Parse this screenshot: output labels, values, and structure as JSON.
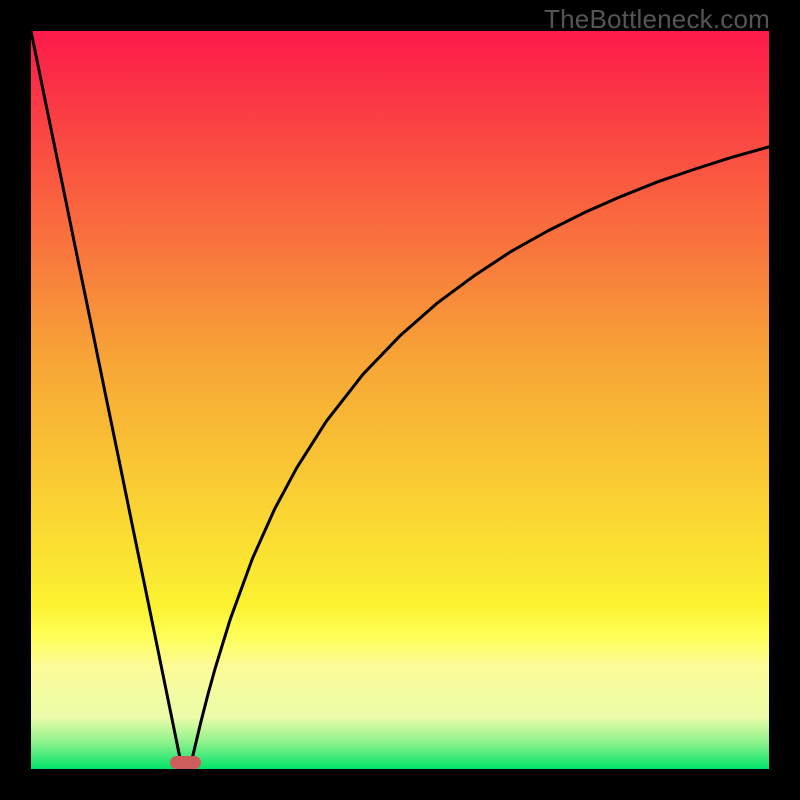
{
  "watermark": "TheBottleneck.com",
  "colors": {
    "frame_background": "#000000",
    "gradient_top": "#fc1a49",
    "gradient_mid1": "#f7a636",
    "gradient_mid2": "#fcf231",
    "gradient_band": "#fdfc98",
    "gradient_bottom": "#00e46a",
    "curve": "#000000",
    "marker": "#cd5d5c",
    "watermark": "#555557"
  },
  "chart_data": {
    "type": "line",
    "title": "",
    "xlabel": "",
    "ylabel": "",
    "xlim": [
      0,
      100
    ],
    "ylim": [
      0,
      100
    ],
    "grid": false,
    "series": [
      {
        "name": "bottleneck-curve",
        "x": [
          0,
          2,
          4,
          6,
          8,
          10,
          12,
          14,
          16,
          18,
          20,
          20.5,
          21.5,
          22,
          23,
          24,
          25,
          27,
          30,
          33,
          36,
          40,
          45,
          50,
          55,
          60,
          65,
          70,
          75,
          80,
          85,
          90,
          95,
          100
        ],
        "values": [
          100.0,
          90.2,
          80.5,
          70.7,
          61.0,
          51.2,
          41.5,
          31.7,
          22.0,
          12.2,
          2.4,
          0.0,
          0.0,
          2.1,
          6.3,
          10.2,
          13.8,
          20.3,
          28.5,
          35.2,
          40.8,
          47.1,
          53.5,
          58.7,
          63.1,
          66.8,
          70.1,
          72.9,
          75.4,
          77.6,
          79.6,
          81.3,
          82.9,
          84.3
        ]
      }
    ],
    "marker": {
      "x_center": 21.0,
      "width": 4.2,
      "y": 0.0
    },
    "gradient_stops": [
      {
        "pos": 0.0,
        "color": "#fc1a49"
      },
      {
        "pos": 0.45,
        "color": "#f7a636"
      },
      {
        "pos": 0.78,
        "color": "#fcf231"
      },
      {
        "pos": 0.82,
        "color": "#feff58"
      },
      {
        "pos": 0.86,
        "color": "#fdfc98"
      },
      {
        "pos": 0.93,
        "color": "#ecfca9"
      },
      {
        "pos": 0.965,
        "color": "#8af18b"
      },
      {
        "pos": 1.0,
        "color": "#00e46a"
      }
    ]
  }
}
